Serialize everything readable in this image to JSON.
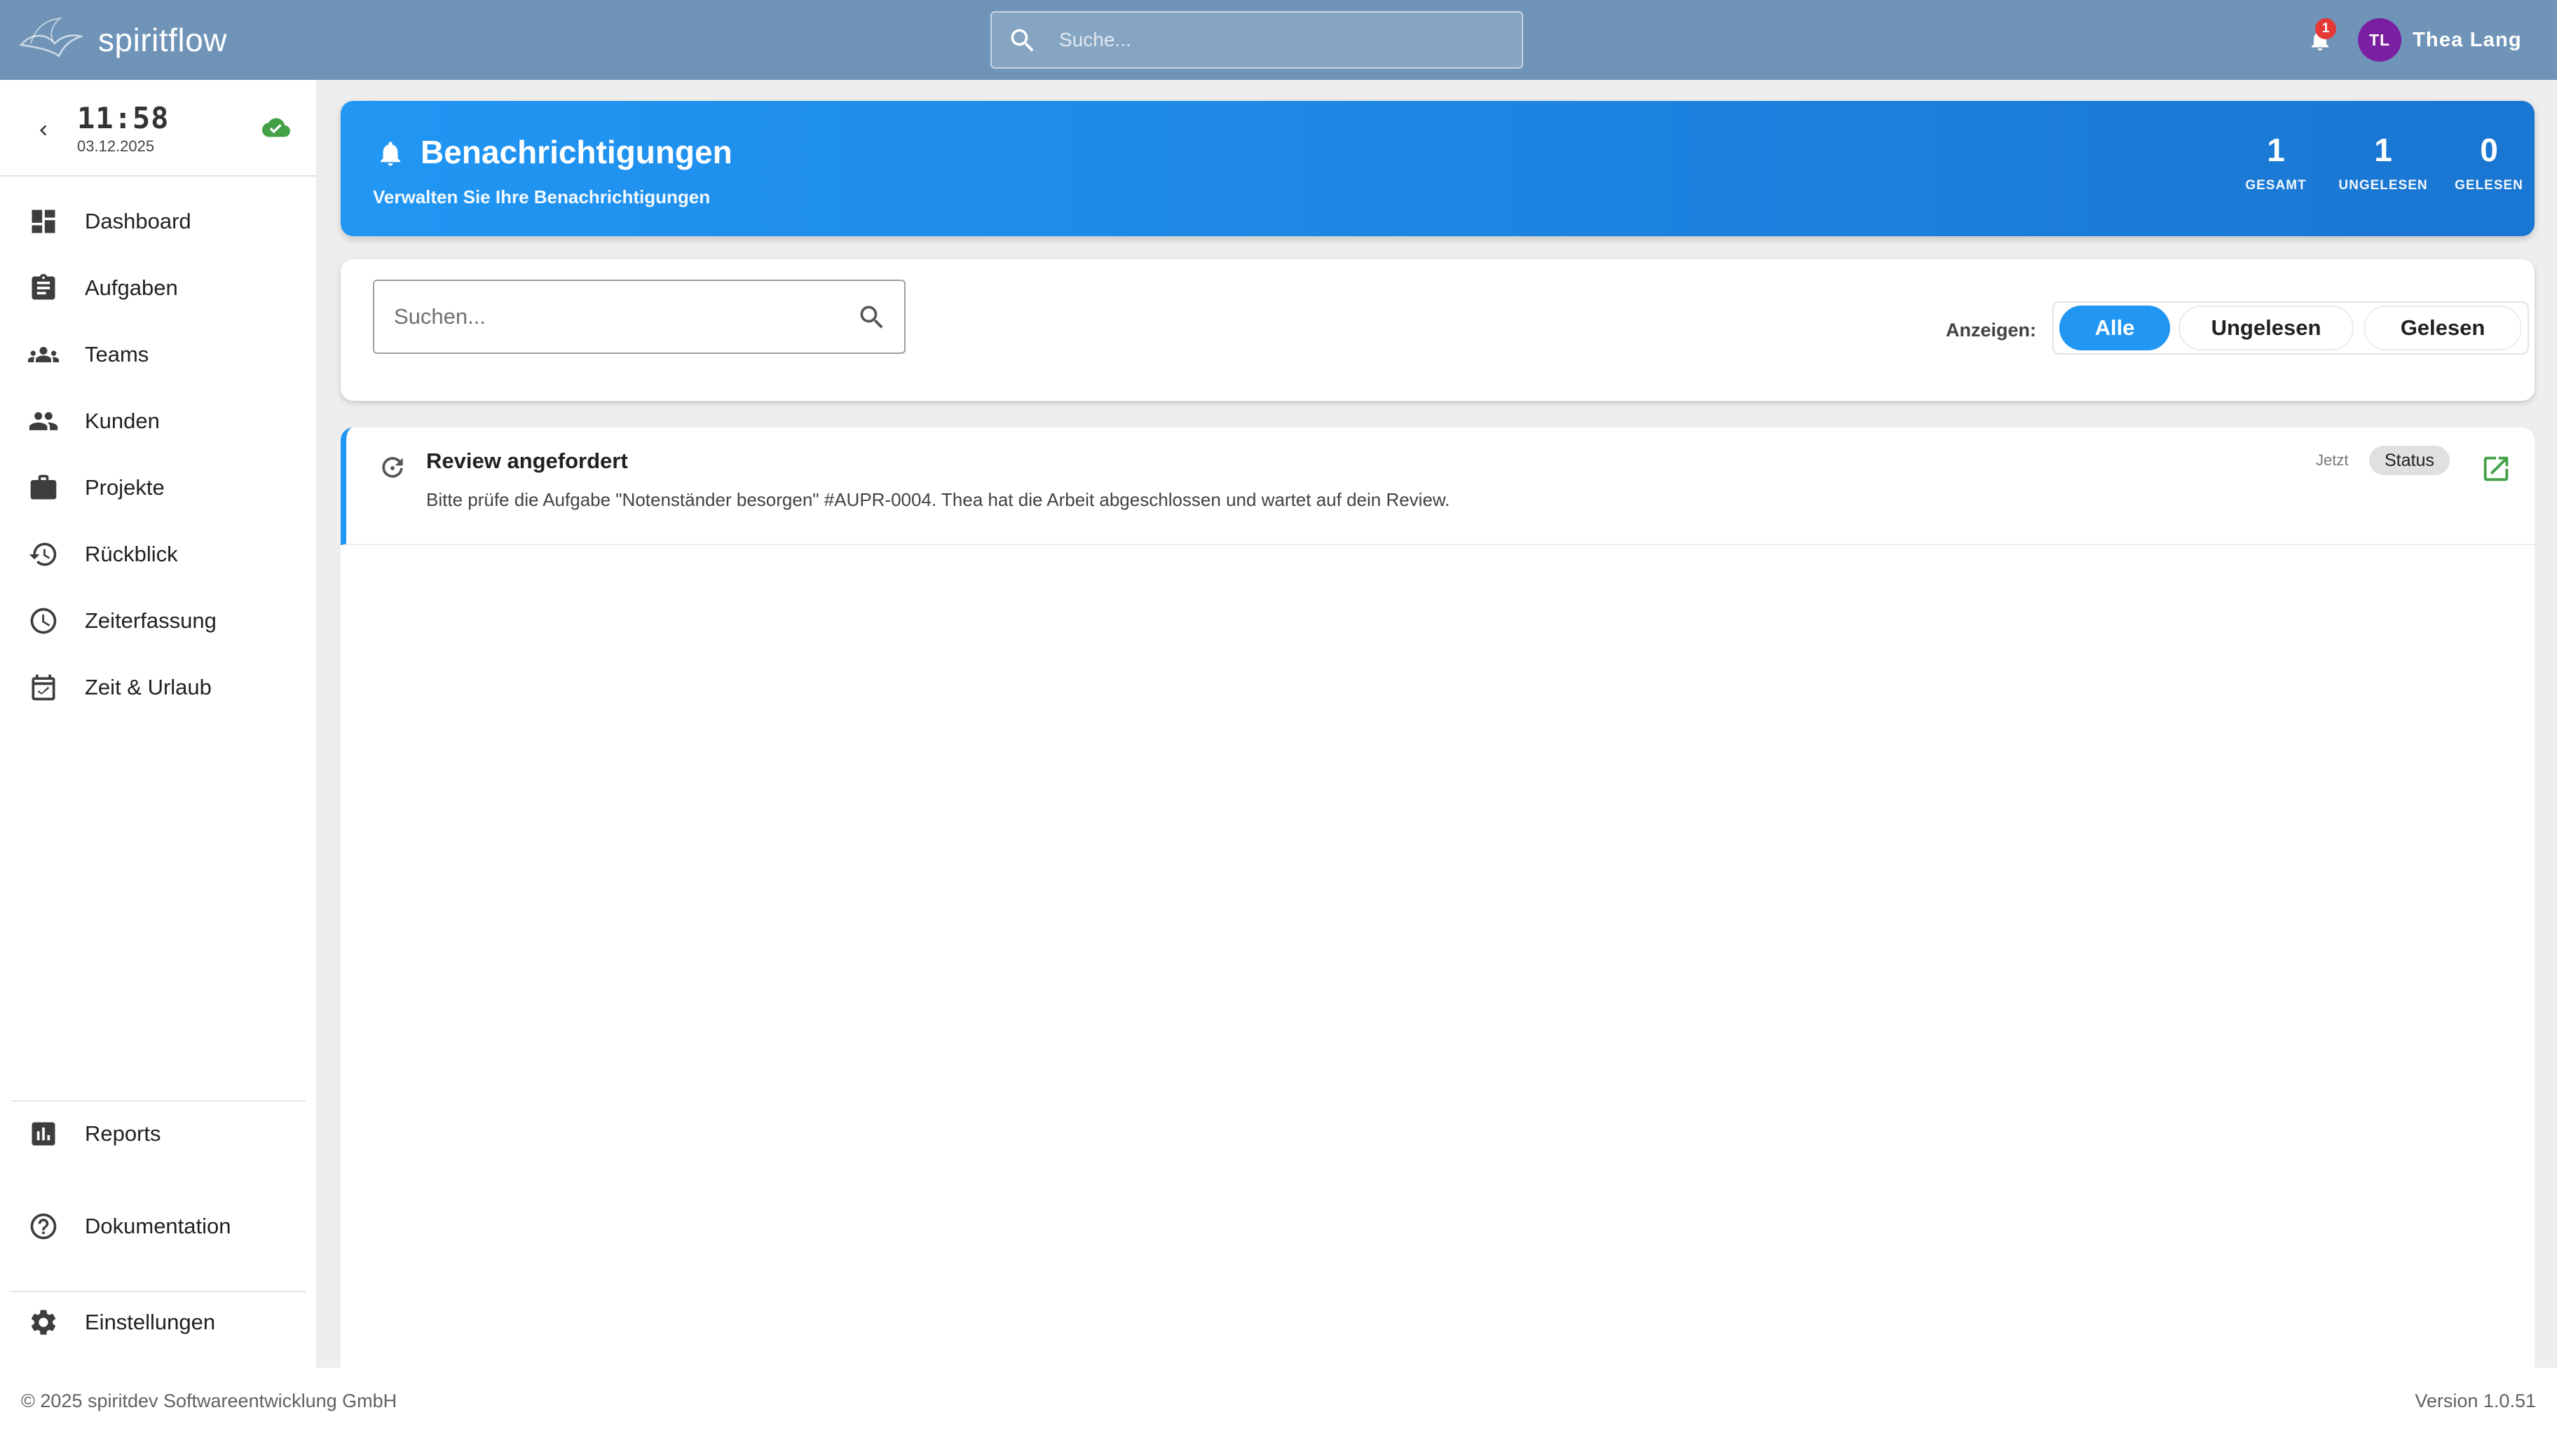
{
  "app": {
    "name": "spiritflow",
    "search_placeholder": "Suche...",
    "notification_count": "1",
    "user": {
      "initials": "TL",
      "name": "Thea Lang"
    }
  },
  "colors": {
    "topbar": "#6f94b8",
    "accent": "#2196f3",
    "avatar": "#7b1fa2",
    "badge": "#e53935",
    "sync_ok": "#43a047",
    "link": "#43a047"
  },
  "sidebar": {
    "clock": {
      "time": "11:58",
      "date": "03.12.2025",
      "sync_icon": "cloud-done-icon"
    },
    "items": [
      {
        "label": "Dashboard",
        "icon": "dashboard-icon"
      },
      {
        "label": "Aufgaben",
        "icon": "clipboard-icon"
      },
      {
        "label": "Teams",
        "icon": "groups-icon"
      },
      {
        "label": "Kunden",
        "icon": "people-icon"
      },
      {
        "label": "Projekte",
        "icon": "briefcase-icon"
      },
      {
        "label": "Rückblick",
        "icon": "history-icon"
      },
      {
        "label": "Zeiterfassung",
        "icon": "clock-icon"
      },
      {
        "label": "Zeit & Urlaub",
        "icon": "calendar-check-icon"
      }
    ],
    "bottom": {
      "reports": "Reports",
      "docs": "Dokumentation",
      "settings": "Einstellungen"
    }
  },
  "header": {
    "title": "Benachrichtigungen",
    "subtitle": "Verwalten Sie Ihre Benachrichtigungen",
    "stats": [
      {
        "value": "1",
        "label": "GESAMT"
      },
      {
        "value": "1",
        "label": "UNGELESEN"
      },
      {
        "value": "0",
        "label": "GELESEN"
      }
    ]
  },
  "filter": {
    "search_placeholder": "Suchen...",
    "show_label": "Anzeigen:",
    "options": [
      "Alle",
      "Ungelesen",
      "Gelesen"
    ],
    "selected": "Alle"
  },
  "notifications": [
    {
      "title": "Review angefordert",
      "text": "Bitte prüfe die Aufgabe \"Notenständer besorgen\" #AUPR-0004. Thea hat die Arbeit abgeschlossen und wartet auf dein Review.",
      "time": "Jetzt",
      "chip": "Status",
      "icon": "refresh-icon",
      "unread": true
    }
  ],
  "footer": {
    "copyright": "© 2025 spiritdev Softwareentwicklung GmbH",
    "version": "Version 1.0.51"
  }
}
